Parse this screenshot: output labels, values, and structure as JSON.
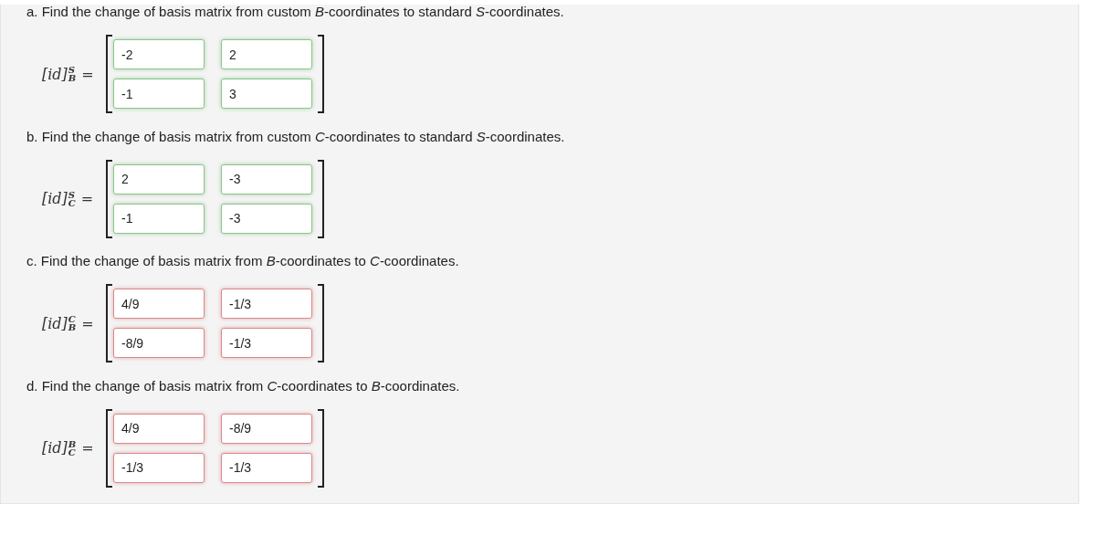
{
  "parts": [
    {
      "prompt": "a. Find the change of basis matrix from custom *B*-coordinates to standard *S*-coordinates.",
      "label": {
        "base": "[id]",
        "sup": "S",
        "sub": "B"
      },
      "equals": "=",
      "rows": [
        [
          {
            "value": "-2",
            "correct": true
          },
          {
            "value": "2",
            "correct": true
          }
        ],
        [
          {
            "value": "-1",
            "correct": true
          },
          {
            "value": "3",
            "correct": true
          }
        ]
      ]
    },
    {
      "prompt": "b. Find the change of basis matrix from custom *C*-coordinates to standard *S*-coordinates.",
      "label": {
        "base": "[id]",
        "sup": "S",
        "sub": "C"
      },
      "equals": "=",
      "rows": [
        [
          {
            "value": "2",
            "correct": true
          },
          {
            "value": "-3",
            "correct": true
          }
        ],
        [
          {
            "value": "-1",
            "correct": true
          },
          {
            "value": "-3",
            "correct": true
          }
        ]
      ]
    },
    {
      "prompt": "c. Find the change of basis matrix from *B*-coordinates to *C*-coordinates.",
      "label": {
        "base": "[id]",
        "sup": "C",
        "sub": "B"
      },
      "equals": "=",
      "rows": [
        [
          {
            "value": "4/9",
            "correct": false
          },
          {
            "value": "-1/3",
            "correct": false
          }
        ],
        [
          {
            "value": "-8/9",
            "correct": false
          },
          {
            "value": "-1/3",
            "correct": false
          }
        ]
      ]
    },
    {
      "prompt": "d. Find the change of basis matrix from *C*-coordinates to *B*-coordinates.",
      "label": {
        "base": "[id]",
        "sup": "B",
        "sub": "C"
      },
      "equals": "=",
      "rows": [
        [
          {
            "value": "4/9",
            "correct": false
          },
          {
            "value": "-8/9",
            "correct": false
          }
        ],
        [
          {
            "value": "-1/3",
            "correct": false
          },
          {
            "value": "-1/3",
            "correct": false
          }
        ]
      ]
    }
  ]
}
